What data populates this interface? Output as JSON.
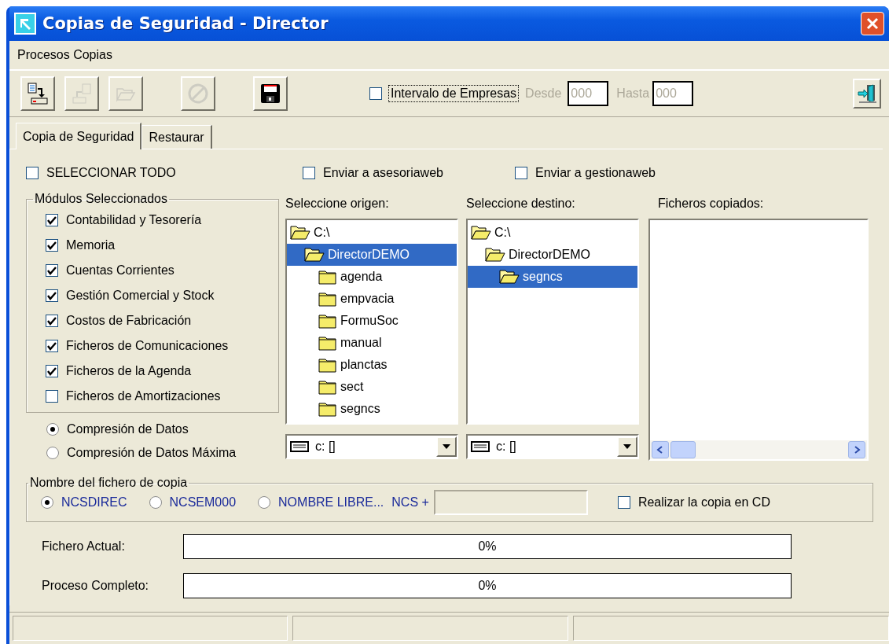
{
  "window": {
    "title": "Copias de Seguridad - Director"
  },
  "menu": [
    "Procesos Copias"
  ],
  "toolbar": {
    "buttons": [
      {
        "kind": "copy",
        "disabled": false
      },
      {
        "kind": "restore",
        "disabled": true
      },
      {
        "kind": "open",
        "disabled": true
      },
      {
        "kind": "cancel",
        "disabled": true
      },
      {
        "kind": "save",
        "disabled": false
      }
    ],
    "interval": {
      "label": "Intervalo de Empresas",
      "checked": false,
      "focused": true
    },
    "from": {
      "label": "Desde",
      "value": "000",
      "disabled": true
    },
    "to": {
      "label": "Hasta",
      "value": "000",
      "disabled": true
    }
  },
  "tabs": [
    {
      "label": "Copia de Seguridad",
      "selected": true
    },
    {
      "label": "Restaurar",
      "selected": false
    }
  ],
  "select_all": {
    "label": "SELECCIONAR TODO",
    "checked": false
  },
  "send_options": [
    {
      "label": "Enviar a asesoriaweb",
      "checked": false
    },
    {
      "label": "Enviar a gestionaweb",
      "checked": false
    }
  ],
  "modules": {
    "title": "Módulos Seleccionados",
    "items": [
      {
        "label": "Contabilidad  y Tesorería",
        "checked": true
      },
      {
        "label": "Memoria",
        "checked": true
      },
      {
        "label": "Cuentas Corrientes",
        "checked": true
      },
      {
        "label": "Gestión Comercial y Stock",
        "checked": true
      },
      {
        "label": "Costos de Fabricación",
        "checked": true
      },
      {
        "label": "Ficheros de Comunicaciones",
        "checked": true
      },
      {
        "label": "Ficheros de la Agenda",
        "checked": true
      },
      {
        "label": "Ficheros de Amortizaciones",
        "checked": false
      }
    ]
  },
  "compression": [
    {
      "label": "Compresión de Datos",
      "selected": true
    },
    {
      "label": "Compresión de Datos Máxima",
      "selected": false
    }
  ],
  "source": {
    "label": "Seleccione origen:",
    "drive": "c: []",
    "tree": [
      {
        "label": "C:\\",
        "expanded": true,
        "selected": false,
        "children": [
          {
            "label": "DirectorDEMO",
            "expanded": true,
            "selected": true,
            "children": [
              {
                "label": "agenda",
                "expanded": false,
                "selected": false
              },
              {
                "label": "empvacia",
                "expanded": false,
                "selected": false
              },
              {
                "label": "FormuSoc",
                "expanded": false,
                "selected": false
              },
              {
                "label": "manual",
                "expanded": false,
                "selected": false
              },
              {
                "label": "planctas",
                "expanded": false,
                "selected": false
              },
              {
                "label": "sect",
                "expanded": false,
                "selected": false
              },
              {
                "label": "segncs",
                "expanded": false,
                "selected": false
              }
            ]
          }
        ]
      }
    ]
  },
  "destination": {
    "label": "Seleccione destino:",
    "drive": "c: []",
    "tree": [
      {
        "label": "C:\\",
        "expanded": true,
        "selected": false,
        "children": [
          {
            "label": "DirectorDEMO",
            "expanded": true,
            "selected": false,
            "children": [
              {
                "label": "segncs",
                "expanded": false,
                "selected": true
              }
            ]
          }
        ]
      }
    ]
  },
  "copied_files": {
    "label": "Ficheros copiados:"
  },
  "file_name": {
    "title": "Nombre del fichero de copia",
    "options": [
      {
        "label": "NCSDIREC",
        "selected": true
      },
      {
        "label": "NCSEM000",
        "selected": false
      },
      {
        "label": "NOMBRE LIBRE...",
        "selected": false
      }
    ],
    "prefix": "NCS +",
    "free_name_disabled": true,
    "cd": {
      "label": "Realizar la copia en CD",
      "checked": false
    }
  },
  "progress": [
    {
      "label": "Fichero Actual:",
      "level": 0,
      "reading": "0%"
    },
    {
      "label": "Proceso Completo:",
      "level": 0,
      "reading": "0%"
    }
  ]
}
